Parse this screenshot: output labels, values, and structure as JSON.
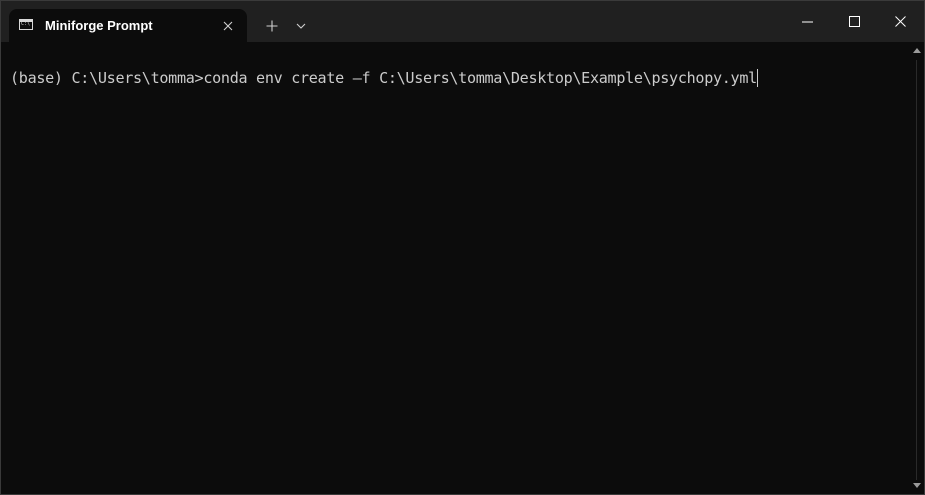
{
  "window": {
    "tab_title": "Miniforge Prompt",
    "tab_icon": "terminal-icon"
  },
  "titlebar": {
    "new_tab_icon": "plus-icon",
    "dropdown_icon": "chevron-down-icon",
    "minimize_icon": "minimize-icon",
    "maximize_icon": "maximize-icon",
    "close_icon": "close-icon"
  },
  "terminal": {
    "prompt": "(base) C:\\Users\\tomma>",
    "command": "conda env create –f C:\\Users\\tomma\\Desktop\\Example\\psychopy.yml"
  },
  "colors": {
    "background": "#0c0c0c",
    "titlebar": "#202020",
    "text": "#cccccc"
  }
}
